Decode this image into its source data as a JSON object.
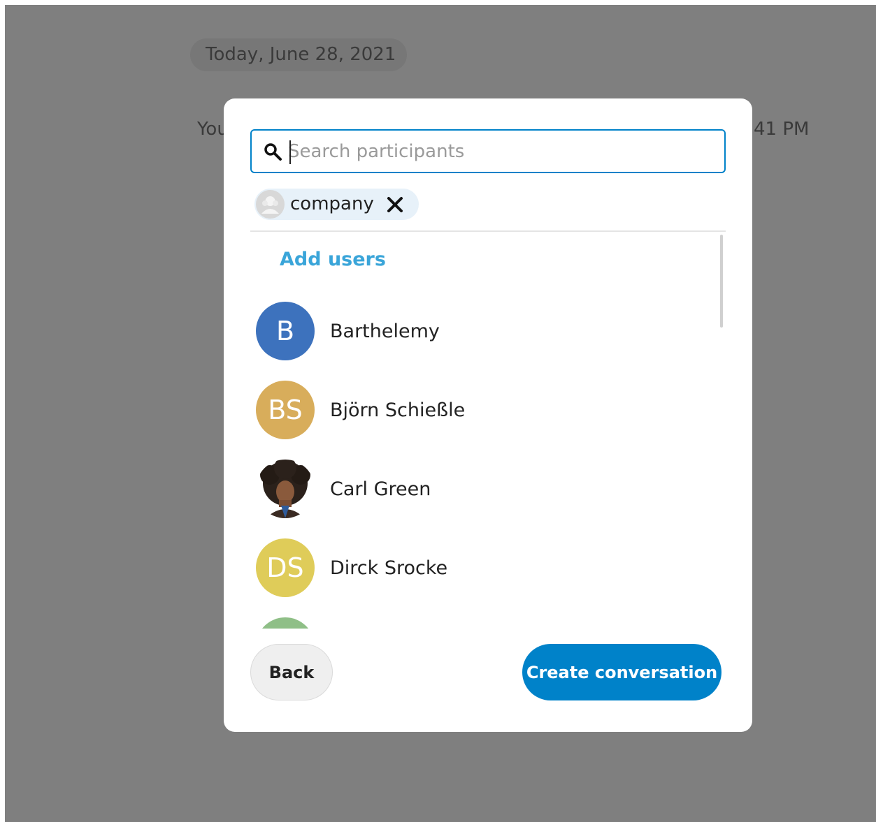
{
  "background": {
    "date_separator": "Today, June 28, 2021",
    "message_left_fragment": "You",
    "message_right_fragment": "41 PM"
  },
  "dialog": {
    "search": {
      "placeholder": "Search participants",
      "value": ""
    },
    "selected_chips": [
      {
        "label": "company",
        "icon": "group-avatar-icon"
      }
    ],
    "section_title": "Add users",
    "users": [
      {
        "name": "Barthelemy",
        "initials": "B",
        "color": "#3d72bd"
      },
      {
        "name": "Björn Schießle",
        "initials": "BS",
        "color": "#d8ad5b"
      },
      {
        "name": "Carl Green",
        "initials": "",
        "color": "#ffffff",
        "photo": true
      },
      {
        "name": "Dirck Srocke",
        "initials": "DS",
        "color": "#dfcc59"
      },
      {
        "name": "",
        "initials": "",
        "color": "#8fbf87"
      }
    ],
    "buttons": {
      "back": "Back",
      "create": "Create conversation"
    }
  },
  "colors": {
    "primary": "#0082c9",
    "link": "#3aa5d9",
    "backdrop": "#7f7f7f"
  }
}
